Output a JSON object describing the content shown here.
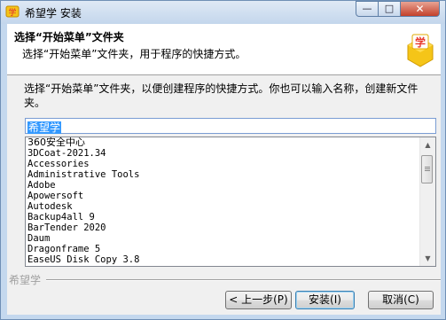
{
  "window": {
    "title": "希望学 安装",
    "min_glyph": "—",
    "max_glyph": "□",
    "close_glyph": "✕"
  },
  "header": {
    "title": "选择“开始菜单”文件夹",
    "subtitle": "选择“开始菜单”文件夹，用于程序的快捷方式。"
  },
  "instruction": "选择“开始菜单”文件夹，以便创建程序的快捷方式。你也可以输入名称，创建新文件夹。",
  "folder_input": {
    "value": "希望学"
  },
  "folder_list": [
    "360安全中心",
    "3DCoat-2021.34",
    "Accessories",
    "Administrative Tools",
    "Adobe",
    "Apowersoft",
    "Autodesk",
    "Backup4all 9",
    "BarTender 2020",
    "Daum",
    "Dragonframe 5",
    "EaseUS Disk Copy 3.8"
  ],
  "scrollbar": {
    "up": "▲",
    "down": "▼"
  },
  "branding": "希望学",
  "buttons": {
    "back": "< 上一步(P)",
    "install": "安装(I)",
    "cancel": "取消(C)"
  },
  "colors": {
    "accent": "#3399ff",
    "logo": "#f5c518",
    "close": "#c3412b"
  }
}
